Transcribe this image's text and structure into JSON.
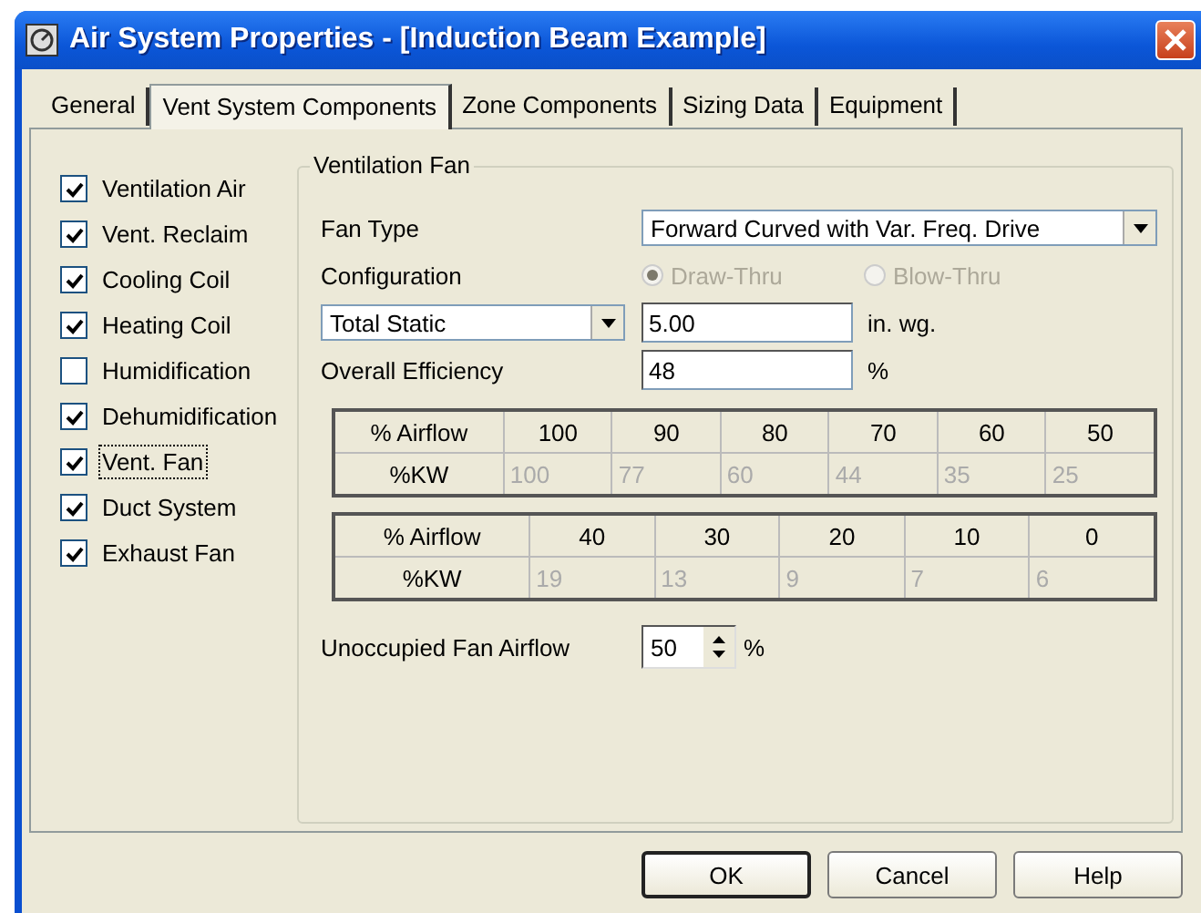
{
  "window": {
    "title": "Air System Properties - [Induction Beam Example]"
  },
  "tabs": [
    {
      "label": "General",
      "selected": false
    },
    {
      "label": "Vent System Components",
      "selected": true
    },
    {
      "label": "Zone Components",
      "selected": false
    },
    {
      "label": "Sizing Data",
      "selected": false
    },
    {
      "label": "Equipment",
      "selected": false
    }
  ],
  "components": [
    {
      "label": "Ventilation Air",
      "checked": true,
      "focused": false
    },
    {
      "label": "Vent. Reclaim",
      "checked": true,
      "focused": false
    },
    {
      "label": "Cooling Coil",
      "checked": true,
      "focused": false
    },
    {
      "label": "Heating Coil",
      "checked": true,
      "focused": false
    },
    {
      "label": "Humidification",
      "checked": false,
      "focused": false
    },
    {
      "label": "Dehumidification",
      "checked": true,
      "focused": false
    },
    {
      "label": "Vent. Fan",
      "checked": true,
      "focused": true
    },
    {
      "label": "Duct System",
      "checked": true,
      "focused": false
    },
    {
      "label": "Exhaust Fan",
      "checked": true,
      "focused": false
    }
  ],
  "ventilation_fan": {
    "title": "Ventilation Fan",
    "fan_type": {
      "label": "Fan Type",
      "value": "Forward Curved with Var. Freq. Drive"
    },
    "configuration": {
      "label": "Configuration",
      "options": [
        {
          "label": "Draw-Thru",
          "selected": true,
          "disabled": true
        },
        {
          "label": "Blow-Thru",
          "selected": false,
          "disabled": true
        }
      ]
    },
    "pressure": {
      "type": "Total Static",
      "value": "5.00",
      "unit": "in. wg."
    },
    "efficiency": {
      "label": "Overall Efficiency",
      "value": "48",
      "unit": "%"
    },
    "tables": [
      {
        "airflow_label": "% Airflow",
        "kw_label": "%KW",
        "airflow": [
          "100",
          "90",
          "80",
          "70",
          "60",
          "50"
        ],
        "kw": [
          "100",
          "77",
          "60",
          "44",
          "35",
          "25"
        ],
        "kw_disabled": true
      },
      {
        "airflow_label": "% Airflow",
        "kw_label": "%KW",
        "airflow": [
          "40",
          "30",
          "20",
          "10",
          "0"
        ],
        "kw": [
          "19",
          "13",
          "9",
          "7",
          "6"
        ],
        "kw_disabled": true
      }
    ],
    "unoccupied": {
      "label": "Unoccupied Fan Airflow",
      "value": "50",
      "unit": "%"
    }
  },
  "buttons": [
    {
      "label": "OK",
      "default": true
    },
    {
      "label": "Cancel",
      "default": false
    },
    {
      "label": "Help",
      "default": false
    }
  ]
}
